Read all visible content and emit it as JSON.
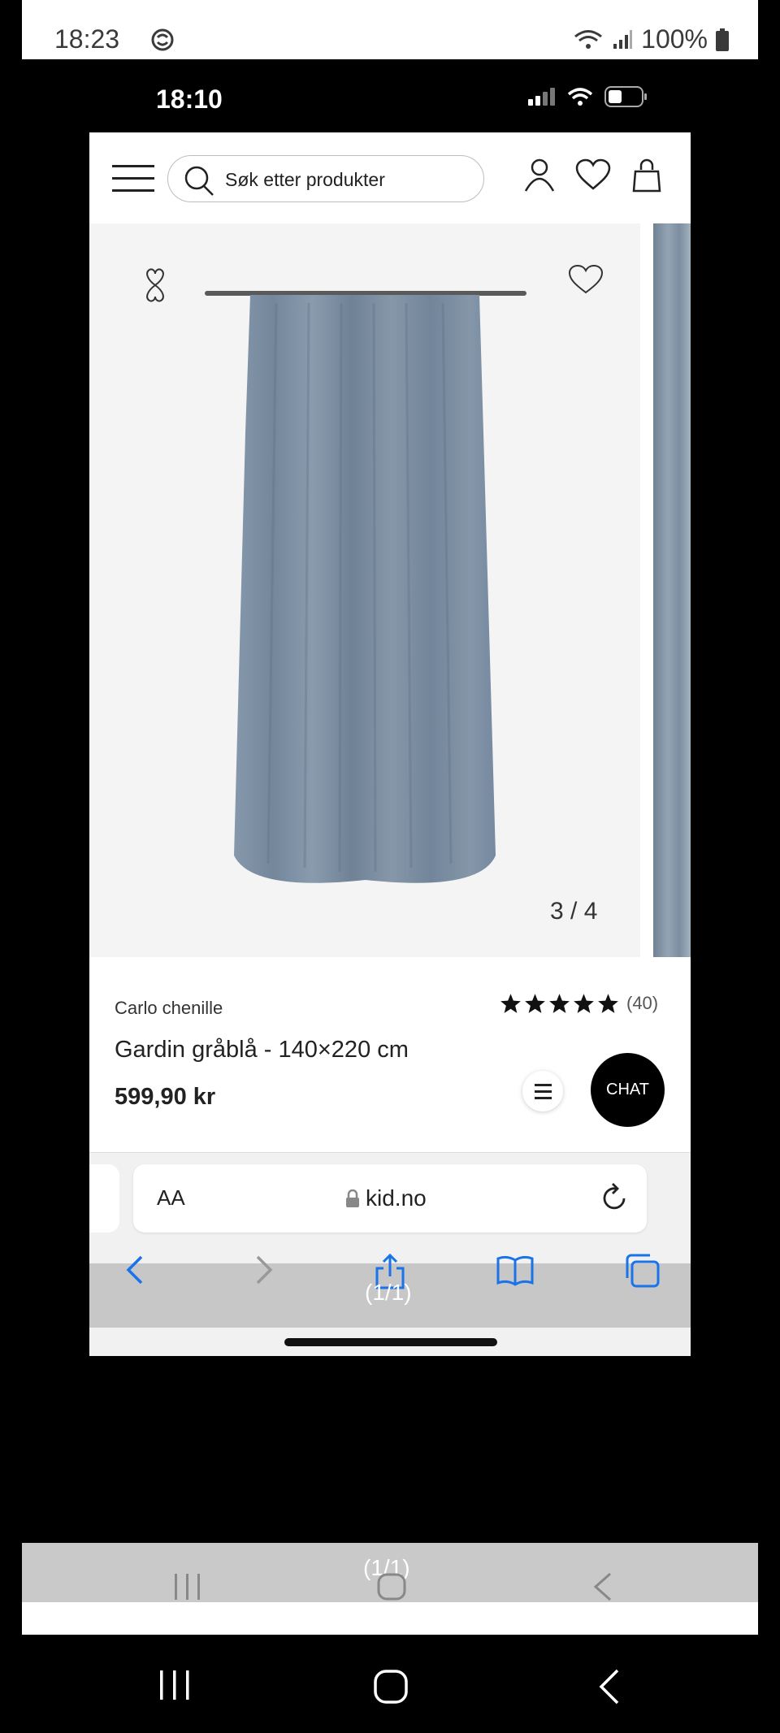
{
  "outer_status": {
    "time": "18:23",
    "battery": "100%"
  },
  "inner_status": {
    "time": "18:10"
  },
  "header": {
    "search_placeholder": "Søk etter produkter"
  },
  "gallery": {
    "counter": "3 / 4"
  },
  "product": {
    "brand": "Carlo chenille",
    "rating_count": "(40)",
    "rating": 5,
    "title": "Gardin gråblå - 140×220 cm",
    "price": "599,90 kr"
  },
  "chat": {
    "label": "CHAT"
  },
  "browser": {
    "text_size_label": "AA",
    "url": "kid.no",
    "page_counter": "(1/1)"
  },
  "bottom_overlay": {
    "page_counter": "(1/1)"
  },
  "colors": {
    "curtain": "#7f92a6",
    "accent_blue": "#1a73e8"
  }
}
